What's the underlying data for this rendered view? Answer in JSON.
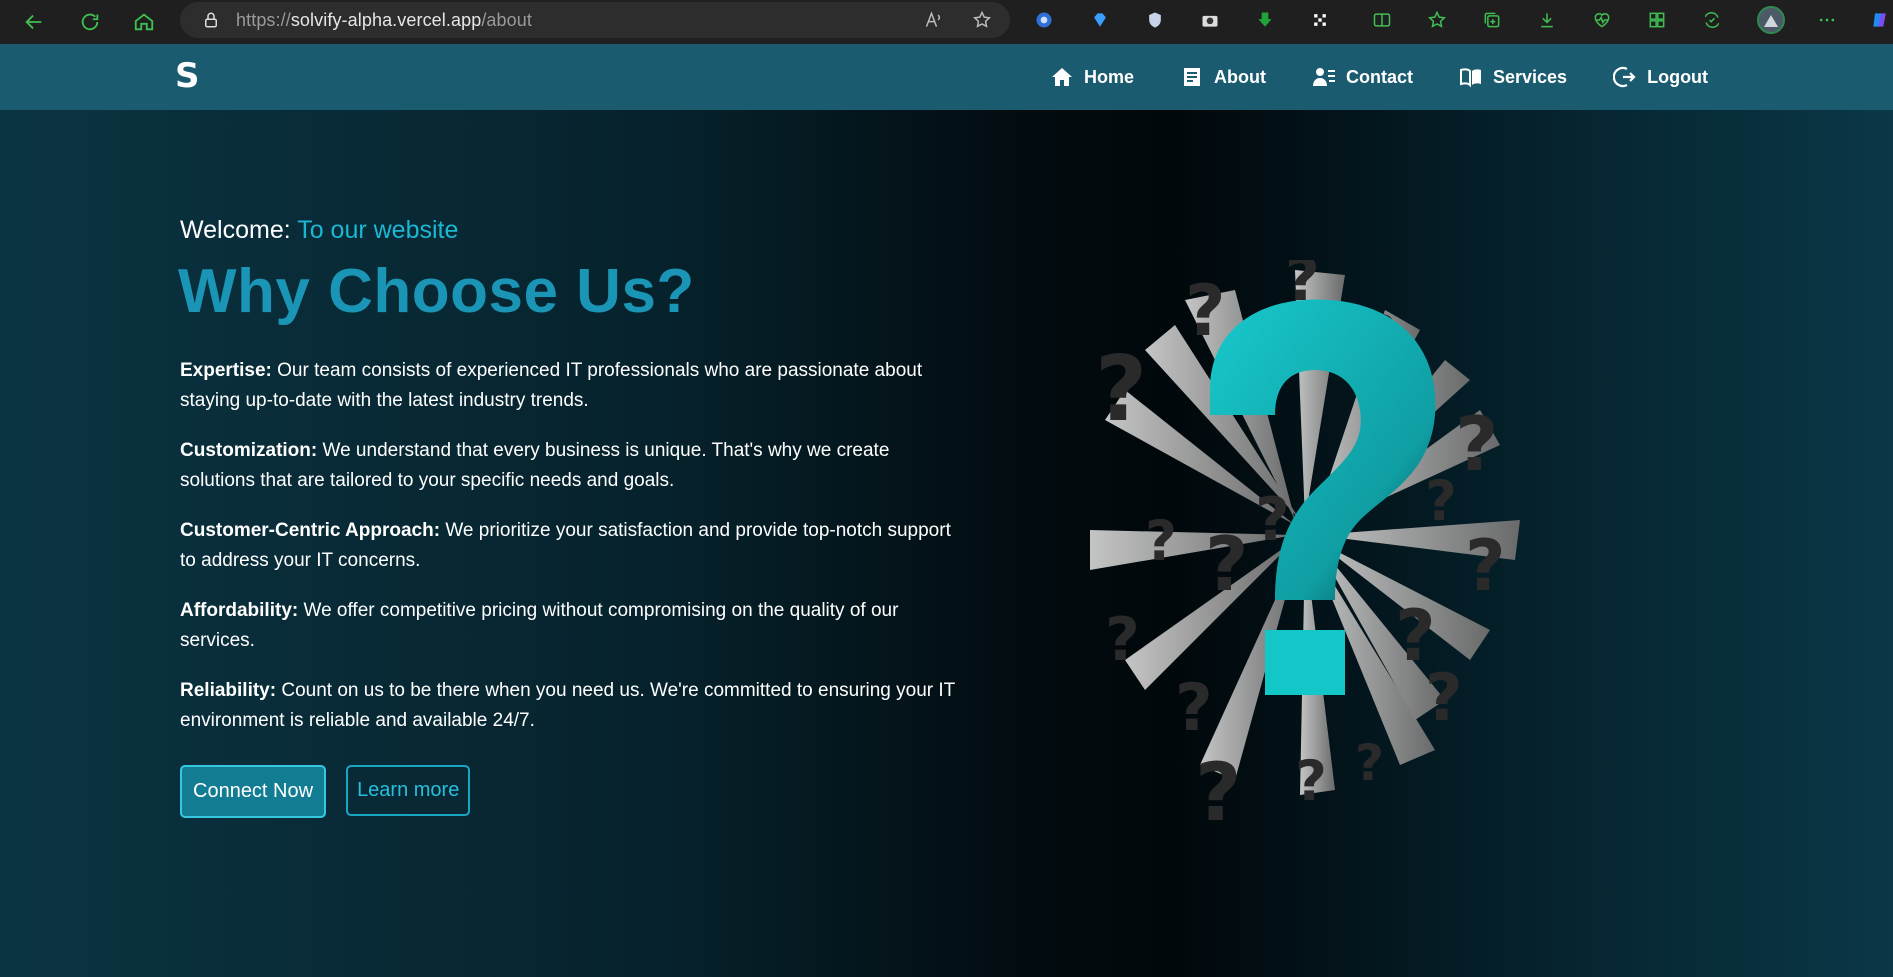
{
  "browser": {
    "url_scheme": "https://",
    "url_host": "solvify-alpha.vercel.app",
    "url_path": "/about"
  },
  "site": {
    "logo": "S",
    "nav": [
      {
        "label": "Home",
        "icon": "home-icon"
      },
      {
        "label": "About",
        "icon": "document-icon"
      },
      {
        "label": "Contact",
        "icon": "contact-card-icon"
      },
      {
        "label": "Services",
        "icon": "book-icon"
      },
      {
        "label": "Logout",
        "icon": "logout-icon"
      }
    ]
  },
  "hero": {
    "welcome_prefix": "Welcome:",
    "welcome_accent": "To our website",
    "title": "Why Choose Us?",
    "features": [
      {
        "term": "Expertise:",
        "text": " Our team consists of experienced IT professionals who are passionate about staying up-to-date with the latest industry trends."
      },
      {
        "term": "Customization:",
        "text": " We understand that every business is unique. That's why we create solutions that are tailored to your specific needs and goals."
      },
      {
        "term": "Customer-Centric Approach:",
        "text": " We prioritize your satisfaction and provide top-notch support to address your IT concerns."
      },
      {
        "term": "Affordability:",
        "text": " We offer competitive pricing without compromising on the quality of our services."
      },
      {
        "term": "Reliability:",
        "text": " Count on us to be there when you need us. We're committed to ensuring your IT environment is reliable and available 24/7."
      }
    ],
    "primary_button": "Connect Now",
    "secondary_button": "Learn more",
    "image_glyph": "?"
  },
  "colors": {
    "navbar": "#1a5b6f",
    "accent": "#1bb7d3",
    "headline": "#1a95b5",
    "question_mark": "#15c4c8"
  }
}
